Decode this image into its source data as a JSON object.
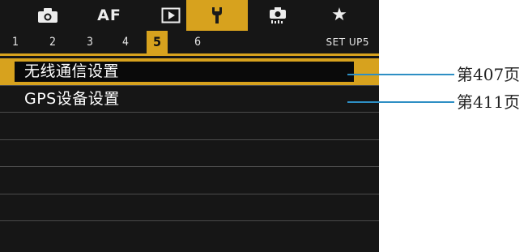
{
  "tabs": {
    "items": [
      {
        "name": "camera-icon",
        "label": ""
      },
      {
        "name": "af-tab",
        "label": "AF"
      },
      {
        "name": "playback-icon",
        "label": ""
      },
      {
        "name": "wrench-icon",
        "label": ""
      },
      {
        "name": "custom-function-icon",
        "label": ""
      },
      {
        "name": "star-icon",
        "label": "★"
      }
    ],
    "active_index": 3
  },
  "pages": {
    "numbers": [
      "1",
      "2",
      "3",
      "4",
      "5",
      "6"
    ],
    "active": "5",
    "name": "SET UP5"
  },
  "menu": {
    "items": [
      {
        "label": "无线通信设置",
        "selected": true
      },
      {
        "label": "GPS设备设置",
        "selected": false
      },
      {
        "label": "",
        "selected": false
      },
      {
        "label": "",
        "selected": false
      },
      {
        "label": "",
        "selected": false
      },
      {
        "label": "",
        "selected": false
      },
      {
        "label": "",
        "selected": false
      }
    ]
  },
  "callouts": [
    {
      "text": "第407页"
    },
    {
      "text": "第411页"
    }
  ],
  "colors": {
    "accent": "#d7a21e",
    "screen_bg": "#161616",
    "callout_line": "#2e8fc4"
  }
}
